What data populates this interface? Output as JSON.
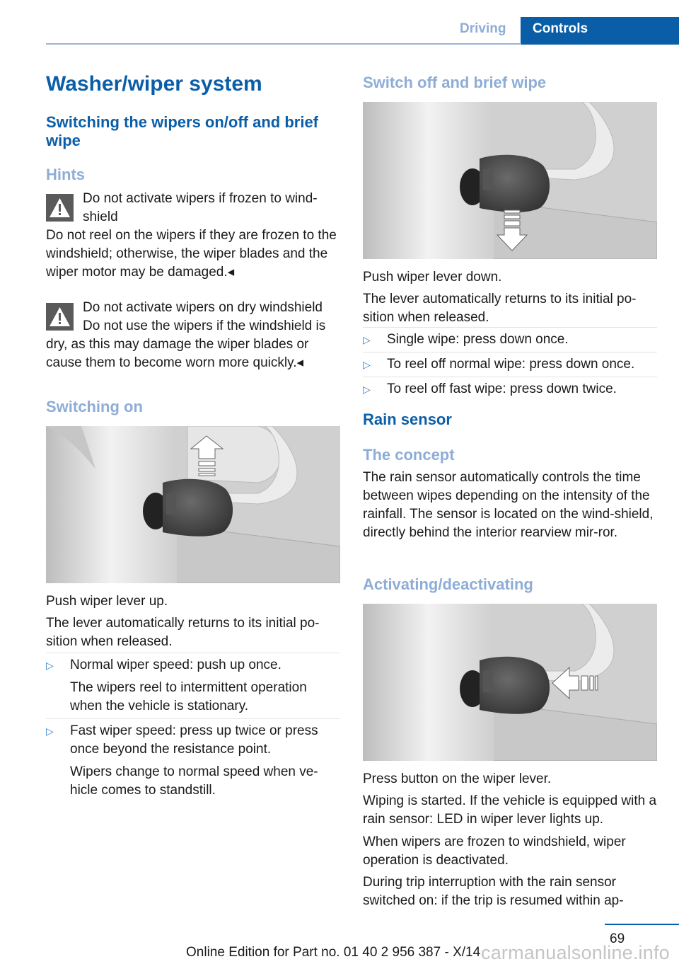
{
  "header": {
    "section": "Driving",
    "active_tab": "Controls"
  },
  "left": {
    "title": "Washer/wiper system",
    "subtitle": "Switching the wipers on/off and brief wipe",
    "hints_heading": "Hints",
    "warnings": [
      {
        "icon": "warning-triangle-icon",
        "title": "Do not activate wipers if frozen to wind-shield",
        "body": "Do not reel on the wipers if they are frozen to the windshield; otherwise, the wiper blades and the wiper motor may be damaged.◂"
      },
      {
        "icon": "warning-triangle-icon",
        "title": "Do not activate wipers on dry windshield",
        "body": "Do not use the wipers if the windshield is dry, as this may damage the wiper blades or cause them to become worn more quickly.◂"
      }
    ],
    "switching_on_heading": "Switching on",
    "switching_on_image": "wiper-lever-up-illustration",
    "switching_on_p1": "Push wiper lever up.",
    "switching_on_p2": "The lever automatically returns to its initial po-sition when released.",
    "switching_on_list": [
      {
        "text": "Normal wiper speed: push up once.",
        "sub": "The wipers reel to intermittent operation when the vehicle is stationary."
      },
      {
        "text": "Fast wiper speed: press up twice or press once beyond the resistance point.",
        "sub": "Wipers change to normal speed when ve-hicle comes to standstill."
      }
    ]
  },
  "right": {
    "switch_off_heading": "Switch off and brief wipe",
    "switch_off_image": "wiper-lever-down-illustration",
    "switch_off_p1": "Push wiper lever down.",
    "switch_off_p2": "The lever automatically returns to its initial po-sition when released.",
    "switch_off_list": [
      {
        "text": "Single wipe: press down once."
      },
      {
        "text": "To reel off normal wipe: press down once."
      },
      {
        "text": "To reel off fast wipe: press down twice."
      }
    ],
    "rain_sensor_heading": "Rain sensor",
    "concept_heading": "The concept",
    "concept_text": "The rain sensor automatically controls the time between wipes depending on the intensity of the rainfall. The sensor is located on the wind-shield, directly behind the interior rearview mir-ror.",
    "activating_heading": "Activating/deactivating",
    "activating_image": "wiper-lever-button-illustration",
    "activating_p1": "Press button on the wiper lever.",
    "activating_p2": "Wiping is started. If the vehicle is equipped with a rain sensor: LED in wiper lever lights up.",
    "activating_p3": "When wipers are frozen to windshield, wiper operation is deactivated.",
    "activating_p4": "During trip interruption with the rain sensor switched on: if the trip is resumed within ap-"
  },
  "footer": {
    "page_number": "69",
    "edition": "Online Edition for Part no. 01 40 2 956 387 - X/14",
    "watermark": "carmanualsonline.info"
  }
}
